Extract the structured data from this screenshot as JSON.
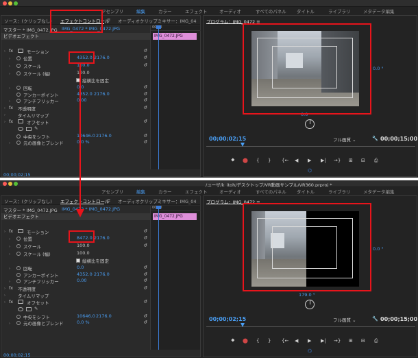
{
  "title_bar": "/ユーザ/k_itoh/デスクトップ/VR動画サンプル/VR360.prproj *",
  "workspaces": [
    "アセンブリ",
    "編集",
    "カラー",
    "エフェクト",
    "オーディオ",
    "すべてのパネル",
    "タイトル",
    "ライブラリ",
    "メタデータ編集"
  ],
  "workspace_active": "編集",
  "top": {
    "tabs": {
      "source": "ソース：(クリップなし)",
      "effect_controls": "エフェクトコントロール",
      "menu": "≡",
      "audio_mixer": "オーディオクリップミキサー：IMG_04"
    },
    "master": "マスター * IMG_0472.JPG",
    "master_clip": "IMG_0472 * IMG_0472.JPG",
    "ruler": "00;00",
    "clip": "IMG_0472.JPG",
    "video_effects": "ビデオエフェクト",
    "motion": "モーション",
    "position_label": "位置",
    "position_x": "4352.0",
    "position_y": "2176.0",
    "scale_label": "スケール",
    "scale_value": "100.0",
    "scale_width_label": "スケール (幅)",
    "scale_width_value": "100.0",
    "uniform_scale": "縦横比を固定",
    "rotation_label": "回転",
    "rotation_value": "0.0",
    "anchor_label": "アンカーポイント",
    "anchor_x": "4352.0",
    "anchor_y": "2176.0",
    "antiflicker_label": "アンチフリッカー",
    "antiflicker_value": "0.00",
    "opacity": "不透明度",
    "time_remap": "タイムリマップ",
    "offset": "オフセット",
    "shift_center_label": "中央をシフト",
    "shift_x": "10646.0",
    "shift_y": "2176.0",
    "blend_label": "元の画像とブレンド",
    "blend_value": "0.0 %",
    "timecode": "00;00;02;15",
    "program_title": "プログラム：IMG_0472 ≡",
    "degree_right": "0.0 °",
    "degree_bottom": "0.0",
    "prog_timecode": "00;00;02;15",
    "quality": "フル画質",
    "duration": "00;00;15;00"
  },
  "bottom": {
    "tabs": {
      "source": "ソース：(クリップなし)",
      "effect_controls": "エフェクトコントロール",
      "menu": "≡",
      "audio_mixer": "オーディオクリップミキサー：IMG_04"
    },
    "master": "マスター * IMG_0472.JPG",
    "master_clip": "IMG_0472 * IMG_0472.JPG",
    "ruler": "00;00",
    "clip": "IMG_0472.JPG",
    "video_effects": "ビデオエフェクト",
    "motion": "モーション",
    "position_label": "位置",
    "position_x": "8472.0",
    "position_y": "2176.0",
    "scale_label": "スケール",
    "scale_value": "100.0",
    "scale_width_label": "スケール (幅)",
    "scale_width_value": "100.0",
    "uniform_scale": "縦横比を固定",
    "rotation_label": "回転",
    "rotation_value": "0.0",
    "anchor_label": "アンカーポイント",
    "anchor_x": "4352.0",
    "anchor_y": "2176.0",
    "antiflicker_label": "アンチフリッカー",
    "antiflicker_value": "0.00",
    "opacity": "不透明度",
    "time_remap": "タイムリマップ",
    "offset": "オフセット",
    "shift_center_label": "中央をシフト",
    "shift_x": "10646.0",
    "shift_y": "2176.0",
    "blend_label": "元の画像とブレンド",
    "blend_value": "0.0 %",
    "timecode": "00;00;02;15",
    "program_title": "プログラム：IMG_0472 ≡",
    "degree_right": "0.0 °",
    "degree_bottom": "179.0 °",
    "prog_timecode": "00;00;02;15",
    "quality": "フル画質",
    "duration": "00;00;15;00"
  },
  "controls": {
    "marker": "⯁",
    "in": "{",
    "out": "}",
    "go_in": "{←",
    "step_back": "◀",
    "play": "▶",
    "step_fwd": "▶|",
    "go_out": "→}",
    "insert": "⊞",
    "overwrite": "⊟",
    "export": "⎙",
    "vr": "⌬",
    "reset": "↺",
    "fx": "fx",
    "wrench": "🔧"
  },
  "colors": {
    "accent": "#4a9ff5",
    "annotation": "#e8141b",
    "clip": "#df8fda",
    "panel": "#2a2a2a"
  }
}
